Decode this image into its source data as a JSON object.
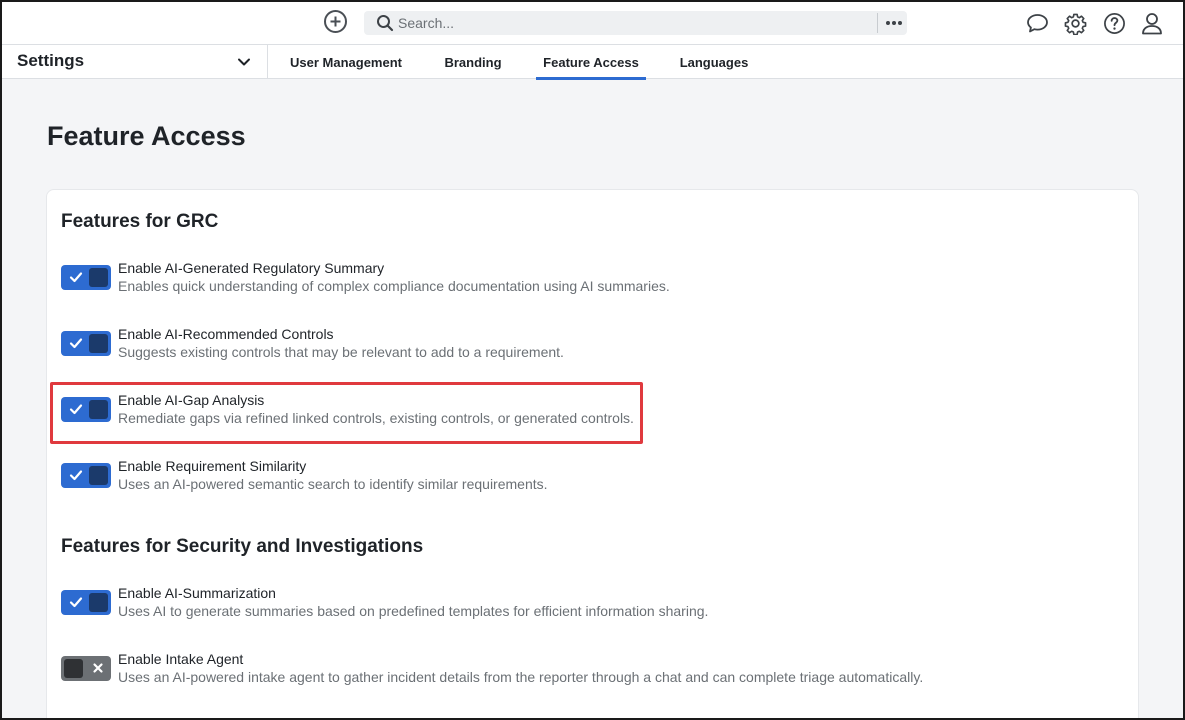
{
  "header": {
    "search_placeholder": "Search..."
  },
  "icons": {
    "add": "plus-circle-icon",
    "search": "search-icon",
    "more": "more-horizontal-icon",
    "chat": "chat-bubble-icon",
    "settings": "gear-icon",
    "help": "help-circle-icon",
    "user": "user-icon",
    "dropdown": "chevron-down-icon"
  },
  "subnav": {
    "settings_label": "Settings",
    "tabs": [
      {
        "label": "User Management",
        "active": false
      },
      {
        "label": "Branding",
        "active": false
      },
      {
        "label": "Feature Access",
        "active": true
      },
      {
        "label": "Languages",
        "active": false
      }
    ]
  },
  "page": {
    "title": "Feature Access"
  },
  "sections": [
    {
      "title": "Features for GRC",
      "features": [
        {
          "title": "Enable AI-Generated Regulatory Summary",
          "description": "Enables quick understanding of complex compliance documentation using AI summaries.",
          "enabled": true
        },
        {
          "title": "Enable AI-Recommended Controls",
          "description": "Suggests existing controls that may be relevant to add to a requirement.",
          "enabled": true
        },
        {
          "title": "Enable AI-Gap Analysis",
          "description": "Remediate gaps via refined linked controls, existing controls, or generated controls.",
          "enabled": true
        },
        {
          "title": "Enable Requirement Similarity",
          "description": "Uses an AI-powered semantic search to identify similar requirements.",
          "enabled": true
        }
      ]
    },
    {
      "title": "Features for Security and Investigations",
      "features": [
        {
          "title": "Enable AI-Summarization",
          "description": "Uses AI to generate summaries based on predefined templates for efficient information sharing.",
          "enabled": true
        },
        {
          "title": "Enable Intake Agent",
          "description": "Uses an AI-powered intake agent to gather incident details from the reporter through a chat and can complete triage automatically.",
          "enabled": false
        }
      ]
    }
  ],
  "colors": {
    "accent": "#2d6bd1",
    "highlight": "#e0393e",
    "toggle_off": "#6c7074"
  }
}
